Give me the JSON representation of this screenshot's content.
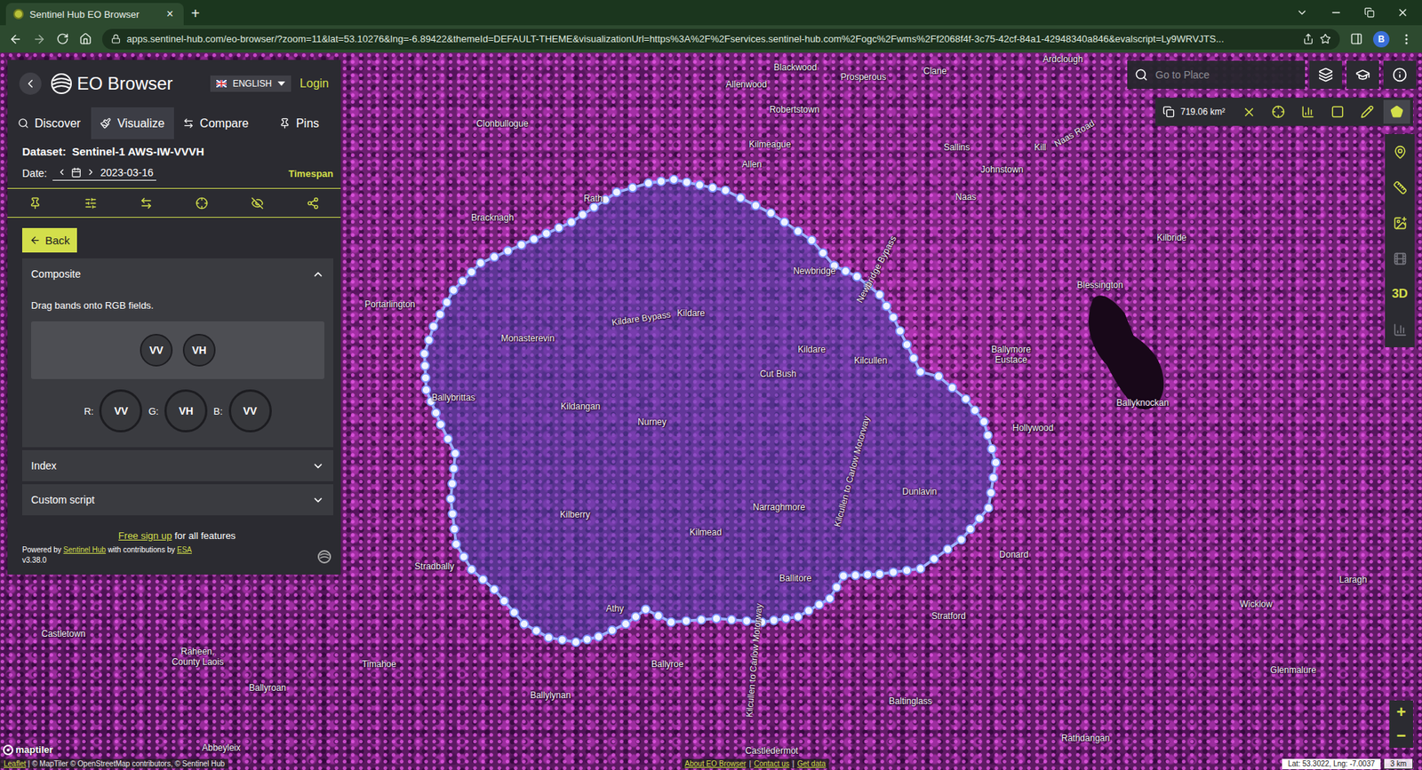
{
  "browser": {
    "tab_title": "Sentinel Hub EO Browser",
    "tab_close": "×",
    "new_tab": "+",
    "url": "apps.sentinel-hub.com/eo-browser/?zoom=11&lat=53.10276&lng=-6.89422&themeId=DEFAULT-THEME&visualizationUrl=https%3A%2F%2Fservices.sentinel-hub.com%2Fogc%2Fwms%2Ff2068f4f-3c75-42cf-84a1-42948340a846&evalscript=Ly9WRVJTS...",
    "profile": "B"
  },
  "panel": {
    "title": "EO Browser",
    "language": "ENGLISH",
    "login": "Login",
    "tabs": [
      {
        "label": "Discover",
        "selected": false
      },
      {
        "label": "Visualize",
        "selected": true
      },
      {
        "label": "Compare",
        "selected": false
      },
      {
        "label": "Pins",
        "selected": false
      }
    ],
    "dataset_label": "Dataset:",
    "dataset": "Sentinel-1 AWS-IW-VVVH",
    "date_label": "Date:",
    "date": "2023-03-16",
    "timespan": "Timespan",
    "back": "Back",
    "sections": [
      {
        "title": "Composite",
        "expanded": true
      },
      {
        "title": "Index",
        "expanded": false
      },
      {
        "title": "Custom script",
        "expanded": false
      }
    ],
    "composite": {
      "hint": "Drag bands onto RGB fields.",
      "bands": [
        "VV",
        "VH"
      ],
      "rgb": [
        {
          "channel": "R:",
          "band": "VV"
        },
        {
          "channel": "G:",
          "band": "VH"
        },
        {
          "channel": "B:",
          "band": "VV"
        }
      ]
    },
    "footer": {
      "signup_link": "Free sign up",
      "signup_rest": "for all features",
      "powered_by": "Powered by",
      "powered_link": "Sentinel Hub",
      "contrib": "with contributions by",
      "contrib_link": "ESA",
      "version": "v3.38.0"
    }
  },
  "map": {
    "search_placeholder": "Go to Place",
    "area": "719.06 km²",
    "draw_modes": [
      {
        "selected": false
      },
      {
        "selected": false
      },
      {
        "selected": true
      }
    ],
    "side_tools": [
      {
        "disabled": false
      },
      {
        "disabled": false
      },
      {
        "disabled": false
      },
      {
        "disabled": true
      },
      {
        "label": "3D",
        "disabled": false
      },
      {
        "disabled": true
      }
    ],
    "labels": [
      {
        "text": "Blackwood"
      },
      {
        "text": "Clane"
      },
      {
        "text": "Ardclough"
      },
      {
        "text": "Allenwood"
      },
      {
        "text": "Prosperous"
      },
      {
        "text": "Robertstown"
      },
      {
        "text": "Clonbullogue"
      },
      {
        "text": "Kilmeague"
      },
      {
        "text": "Allen"
      },
      {
        "text": "Sallins"
      },
      {
        "text": "Kill"
      },
      {
        "text": "Naas Road"
      },
      {
        "text": "Johnstown"
      },
      {
        "text": "Naas"
      },
      {
        "text": "Bracknagh"
      },
      {
        "text": "Rath"
      },
      {
        "text": "Kilbride"
      },
      {
        "text": "Newbridge"
      },
      {
        "text": "Newbridge Bypass"
      },
      {
        "text": "Portarlington"
      },
      {
        "text": "Blessington"
      },
      {
        "text": "Kildare Bypass"
      },
      {
        "text": "Kildare"
      },
      {
        "text": "Monasterevin"
      },
      {
        "text": "Kildare"
      },
      {
        "text": "Kilcullen"
      },
      {
        "text": "Ballymore Eustace"
      },
      {
        "text": "Cut Bush"
      },
      {
        "text": "Ballybrittas"
      },
      {
        "text": "Ballyknockan"
      },
      {
        "text": "Kildangan"
      },
      {
        "text": "Nurney"
      },
      {
        "text": "Hollywood"
      },
      {
        "text": "Kilcullen to Carlow Motorway"
      },
      {
        "text": "Dunlavin"
      },
      {
        "text": "Narraghmore"
      },
      {
        "text": "Kilberry"
      },
      {
        "text": "Kilmead"
      },
      {
        "text": "Donard"
      },
      {
        "text": "Stradbally"
      },
      {
        "text": "Ballitore"
      },
      {
        "text": "Laragh"
      },
      {
        "text": "Wicklow"
      },
      {
        "text": "Athy"
      },
      {
        "text": "Stratford"
      },
      {
        "text": "Castletown"
      },
      {
        "text": "Raheen, County Laois"
      },
      {
        "text": "Timahoe"
      },
      {
        "text": "Ballyroe"
      },
      {
        "text": "Kilcullen to Carlow Motorway"
      },
      {
        "text": "Glenmalure"
      },
      {
        "text": "Ballyroan"
      },
      {
        "text": "Ballylynan"
      },
      {
        "text": "Baltinglass"
      },
      {
        "text": "Rathdangan"
      },
      {
        "text": "Abbeyleix"
      },
      {
        "text": "Castledermot"
      }
    ],
    "zoom_in": "+",
    "zoom_out": "−",
    "maptiler": "maptiler",
    "attribution_lead": "Leaflet",
    "attribution": "| © MapTiler © OpenStreetMap contributors, © Sentinel Hub",
    "links": [
      "About EO Browser",
      "Contact us",
      "Get data"
    ],
    "link_separator": "|",
    "coords": "Lat: 53.3022, Lng: -7.0037",
    "scale": "3 km"
  }
}
